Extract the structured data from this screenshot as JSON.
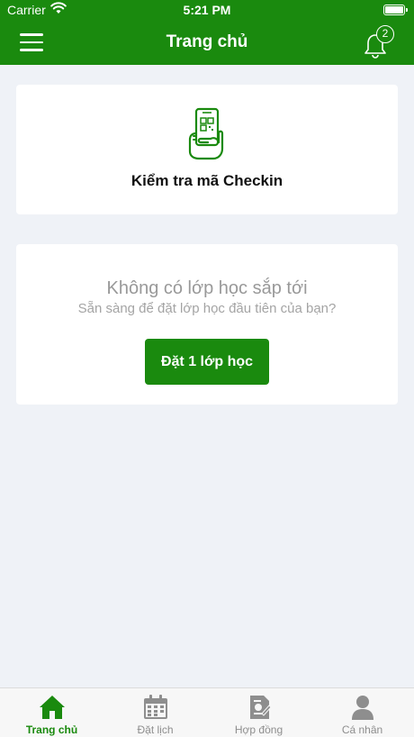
{
  "status_bar": {
    "carrier": "Carrier",
    "time": "5:21 PM"
  },
  "nav": {
    "title": "Trang chủ",
    "notification_count": "2"
  },
  "checkin_card": {
    "icon": "phone-qr-icon",
    "label": "Kiểm tra mã Checkin"
  },
  "empty_state": {
    "title": "Không có lớp học sắp tới",
    "subtitle": "Sẵn sàng để đặt lớp học đầu tiên của bạn?",
    "button_label": "Đặt 1 lớp học"
  },
  "tabs": [
    {
      "label": "Trang chủ",
      "icon": "home-icon",
      "active": true
    },
    {
      "label": "Đặt lịch",
      "icon": "calendar-icon",
      "active": false
    },
    {
      "label": "Hợp đồng",
      "icon": "contract-icon",
      "active": false
    },
    {
      "label": "Cá nhân",
      "icon": "person-icon",
      "active": false
    }
  ],
  "colors": {
    "primary": "#1a8a0e",
    "background": "#eff2f7",
    "inactive_tab": "#8e8e8e"
  }
}
